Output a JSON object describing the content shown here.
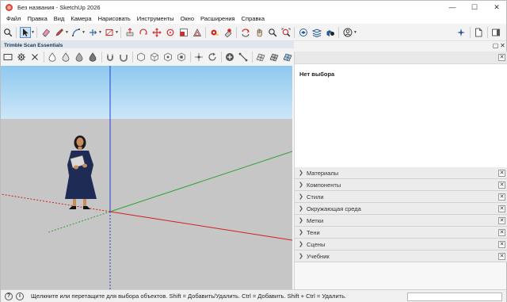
{
  "window": {
    "title": "Без названия - SketchUp 2026"
  },
  "menu": [
    "Файл",
    "Правка",
    "Вид",
    "Камера",
    "Нарисовать",
    "Инструменты",
    "Окно",
    "Расширения",
    "Справка"
  ],
  "toolbar2": {
    "title": "Trimble Scan Essentials"
  },
  "entity_info": {
    "heading": "Нет выбора"
  },
  "trays": [
    "Материалы",
    "Компоненты",
    "Стили",
    "Окружающая среда",
    "Метки",
    "Тени",
    "Сцены",
    "Учебник"
  ],
  "status": {
    "hint": "Щелкните или перетащите для выбора объектов. Shift = Добавить/Удалить. Ctrl = Добавить. Shift + Ctrl = Удалить.",
    "measurements_value": ""
  },
  "colors": {
    "accent": "#3a74b8",
    "sky": "#8ec8ef",
    "ground": "#c6c6c6",
    "axis_red": "#d02020",
    "axis_green": "#30a030",
    "axis_blue": "#2040d0"
  },
  "icons": {
    "toolbar1": [
      "search-icon",
      "select-arrow-icon",
      "eraser-icon",
      "pencil-icon",
      "line-icon",
      "arc-icon",
      "rectangle-icon",
      "push-pull-icon",
      "orbit-icon",
      "move-icon",
      "rotate-icon",
      "scale-icon",
      "offset-icon",
      "tape-measure-icon",
      "section-plane-icon",
      "paint-bucket-icon",
      "pan-icon",
      "zoom-icon",
      "zoom-extents-icon",
      "3d-warehouse-icon",
      "layer-icon",
      "component-icon",
      "account-icon",
      "ai-sparkle-icon",
      "document-icon",
      "display-panel-icon"
    ],
    "toolbar2": [
      "scan-frame-icon",
      "settings-icon",
      "close-icon",
      "drop-outline-icon",
      "drop-half-icon",
      "drop-filled-icon",
      "drop-dark-icon",
      "magnet-icon",
      "hex-icon",
      "cube-icon",
      "point-icon",
      "refresh-icon",
      "add-icon",
      "line-tool-icon",
      "mesh-icon",
      "layers-icon"
    ]
  }
}
